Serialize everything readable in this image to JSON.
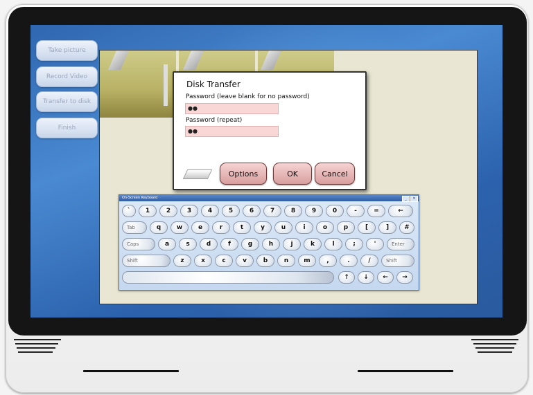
{
  "side_menu": [
    "Take picture",
    "Record Video",
    "Transfer to disk",
    "Finish"
  ],
  "dialog": {
    "title": "Disk Transfer",
    "password_label": "Password (leave blank for no password)",
    "password_value": "●●",
    "password_repeat_label": "Password (repeat)",
    "password_repeat_value": "●●",
    "options_label": "Options",
    "ok_label": "OK",
    "cancel_label": "Cancel"
  },
  "keyboard": {
    "title": "On-Screen Keyboard",
    "rows": [
      [
        "`",
        "1",
        "2",
        "3",
        "4",
        "5",
        "6",
        "7",
        "8",
        "9",
        "0",
        "-",
        "=",
        "←"
      ],
      [
        "Tab",
        "q",
        "w",
        "e",
        "r",
        "t",
        "y",
        "u",
        "i",
        "o",
        "p",
        "[",
        "]",
        "#"
      ],
      [
        "Caps",
        "a",
        "s",
        "d",
        "f",
        "g",
        "h",
        "j",
        "k",
        "l",
        ";",
        "'",
        "Enter"
      ],
      [
        "Shift",
        "z",
        "x",
        "c",
        "v",
        "b",
        "n",
        "m",
        ",",
        ".",
        "/",
        "Shift"
      ],
      [
        "",
        "↑",
        "↓",
        "←",
        "→"
      ]
    ]
  },
  "colors": {
    "screen_blue": "#3a74bf",
    "dialog_button": "#e6b4b4",
    "password_field": "#f9d7d7"
  }
}
